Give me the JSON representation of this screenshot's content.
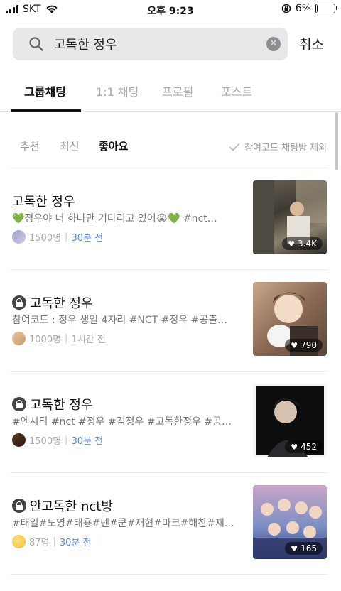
{
  "status_bar": {
    "carrier": "SKT",
    "time": "오후 9:23",
    "battery_text": "6%",
    "battery_level": 0.06
  },
  "search": {
    "query": "고독한 정우",
    "placeholder": "",
    "clear_icon": "clear-icon",
    "cancel_label": "취소"
  },
  "tabs": [
    {
      "label": "그룹채팅",
      "active": true
    },
    {
      "label": "1:1 채팅",
      "active": false
    },
    {
      "label": "프로필",
      "active": false
    },
    {
      "label": "포스트",
      "active": false
    }
  ],
  "filters": [
    {
      "label": "추천",
      "active": false
    },
    {
      "label": "최신",
      "active": false
    },
    {
      "label": "좋아요",
      "active": true
    }
  ],
  "exclude_label": "참여코드 채팅방 제외",
  "rooms": [
    {
      "title": "고독한 정우",
      "locked": false,
      "desc": "💚정우야 너 하나만 기다리고 있어😭💚 #nct…",
      "members": "1500명",
      "time": "30분 전",
      "recent": true,
      "likes": "3.4K"
    },
    {
      "title": "고독한 정우",
      "locked": true,
      "desc": "참여코드 : 정우 생일 4자리 #NCT #정우 #공출…",
      "members": "1000명",
      "time": "1시간 전",
      "recent": false,
      "likes": "790"
    },
    {
      "title": "고독한 정우",
      "locked": true,
      "desc": "#엔시티 #nct #정우 #김정우 #고독한정우 #공…",
      "members": "1500명",
      "time": "30분 전",
      "recent": true,
      "likes": "452"
    },
    {
      "title": "안고독한 nct방",
      "locked": true,
      "desc": "#태일#도영#태용#텐#쿤#재현#마크#해찬#재…",
      "members": "87명",
      "time": "30분 전",
      "recent": true,
      "likes": "165"
    }
  ],
  "colors": {
    "recent_time": "#5b8bd4",
    "tab_active": "#111111",
    "search_bg": "#e8e8ea"
  }
}
